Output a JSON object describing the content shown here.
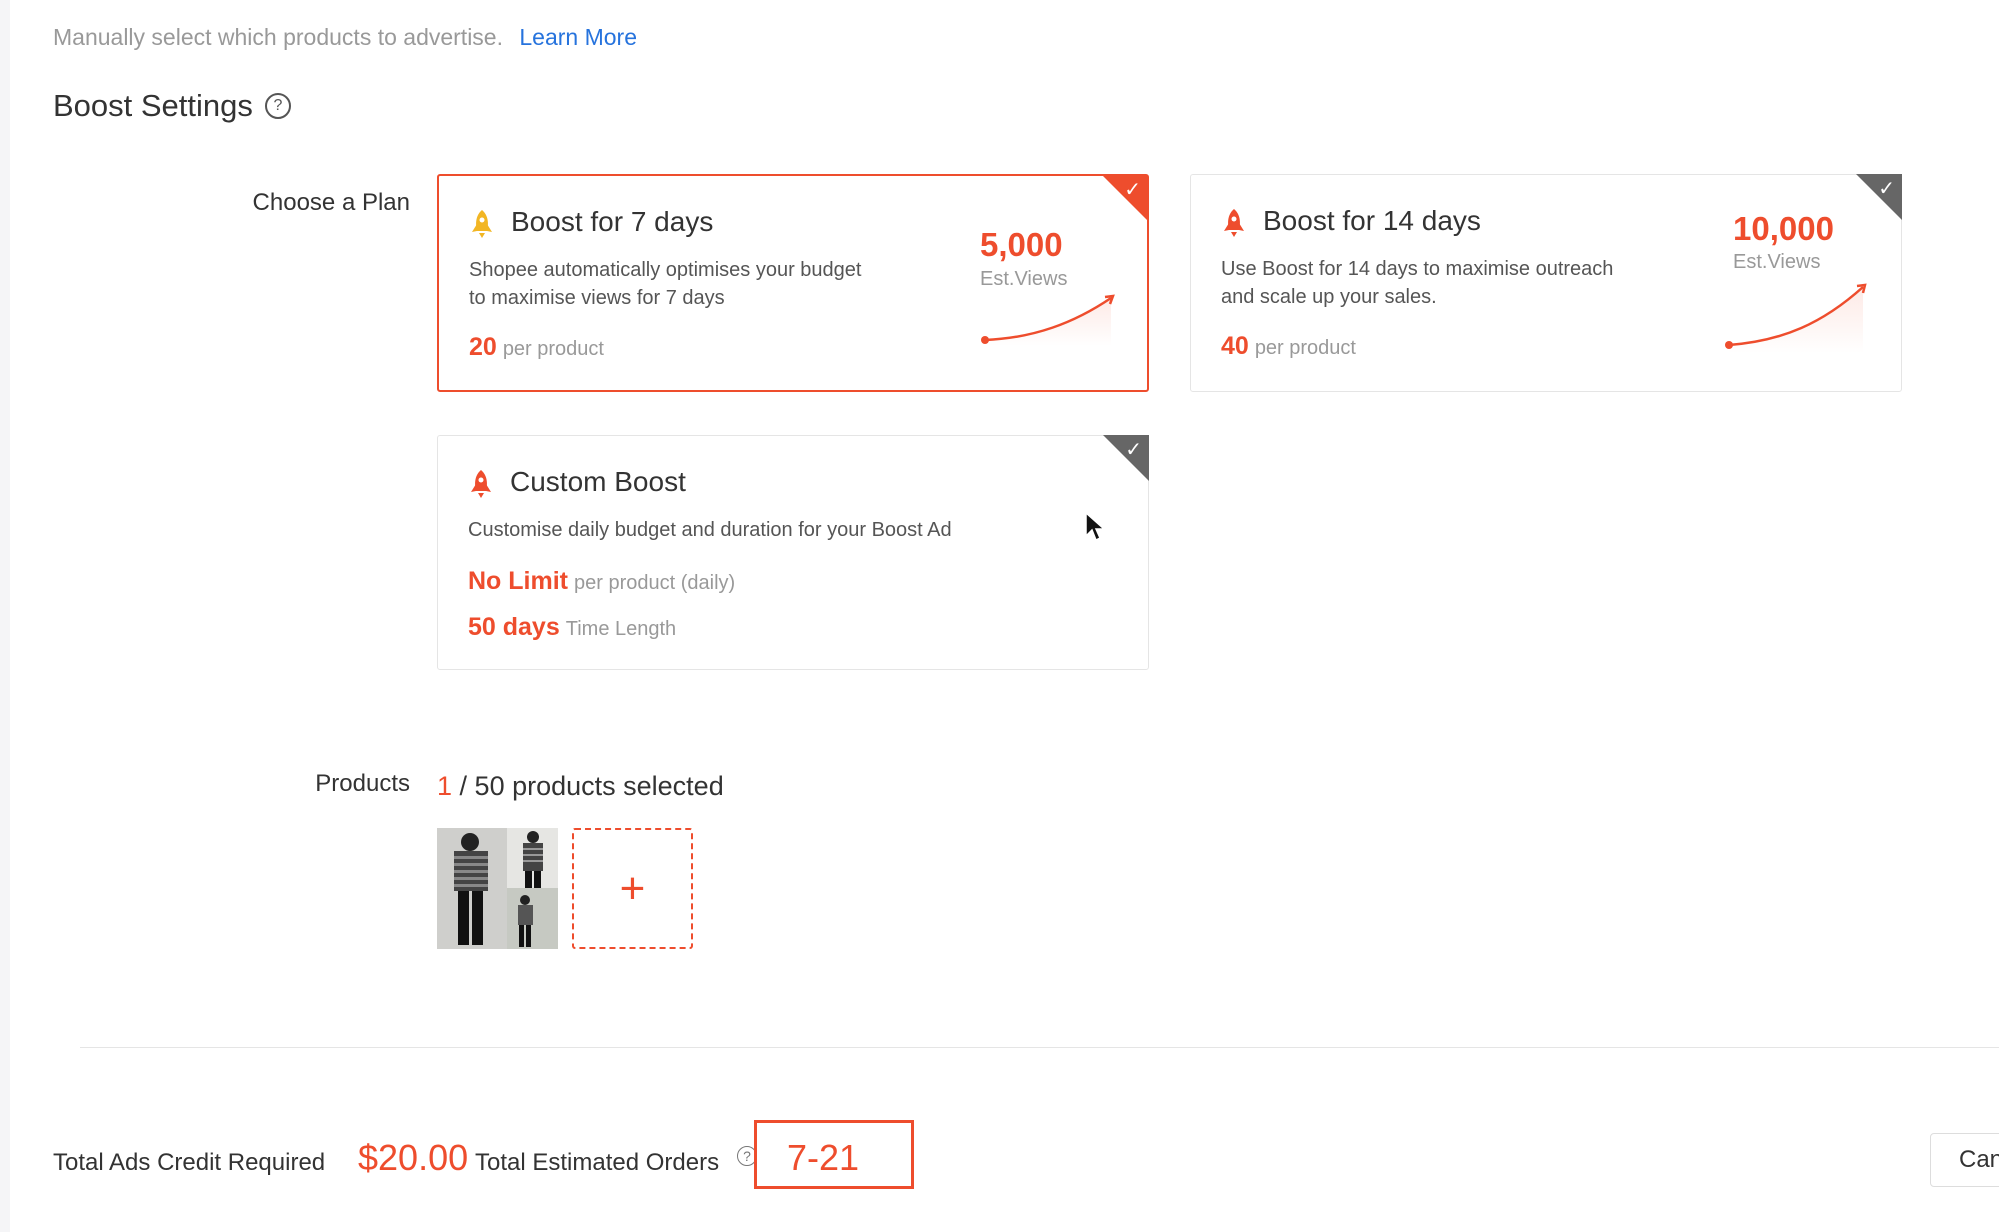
{
  "intro": {
    "text": "Manually select which products to advertise.",
    "link": "Learn More"
  },
  "boost_settings": {
    "title": "Boost Settings",
    "help_icon": "?"
  },
  "plan": {
    "label": "Choose a Plan",
    "cards": [
      {
        "title": "Boost for 7 days",
        "desc_line1": "Shopee automatically optimises your budget",
        "desc_line2": "to maximise views for 7 days",
        "price": "20",
        "price_unit": "per product",
        "est_value": "5,000",
        "est_label": "Est.Views",
        "selected": true
      },
      {
        "title": "Boost for 14 days",
        "desc_line1": "Use Boost for 14 days to maximise outreach",
        "desc_line2": "and scale up your sales.",
        "price": "40",
        "price_unit": "per product",
        "est_value": "10,000",
        "est_label": "Est.Views",
        "selected": false
      },
      {
        "title": "Custom Boost",
        "desc": "Customise daily budget and duration for your Boost Ad",
        "limit_value": "No Limit",
        "limit_unit": "per product (daily)",
        "days_value": "50 days",
        "days_unit": "Time Length",
        "selected": false
      }
    ]
  },
  "products": {
    "label": "Products",
    "selected_count": "1",
    "count_text": "/ 50 products selected",
    "add_symbol": "+"
  },
  "footer": {
    "credit_label": "Total Ads Credit Required",
    "credit_value": "$20.00",
    "orders_label": "Total Estimated Orders",
    "orders_help": "?",
    "orders_value": "7-21",
    "cancel_label": "Can"
  },
  "colors": {
    "accent": "#ee4d2d",
    "link": "#2673dd",
    "muted": "#999999",
    "unselected_corner": "#666666"
  },
  "icons": [
    "help-circle-icon",
    "rocket-icon",
    "checkmark-icon",
    "trend-curve-icon",
    "plus-icon",
    "mouse-cursor-icon"
  ]
}
